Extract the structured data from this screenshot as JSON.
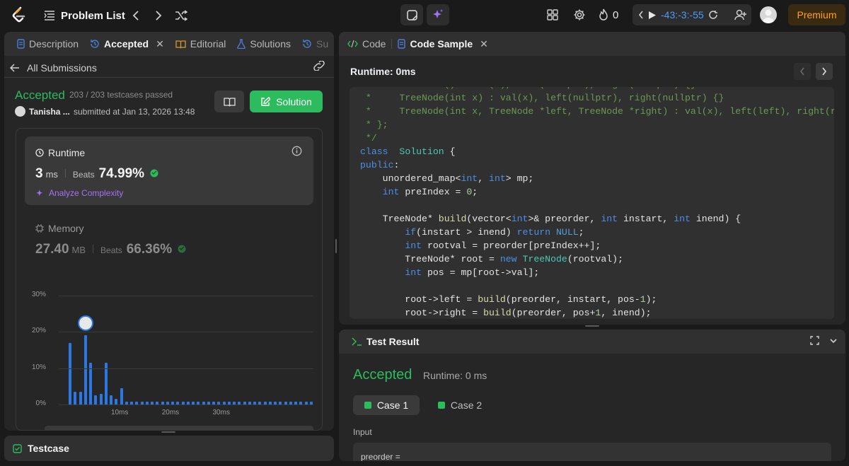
{
  "topbar": {
    "problem_list": "Problem List",
    "streak": "0",
    "timer": "-43:-3:-55",
    "premium": "Premium"
  },
  "left_tabs": [
    "Description",
    "Accepted",
    "Editorial",
    "Solutions",
    "Su"
  ],
  "submission": {
    "back_label": "All Submissions",
    "status": "Accepted",
    "testcases": "203 / 203 testcases passed",
    "user": "Tanisha ...",
    "submitted": "submitted at Jan 13, 2026 13:48",
    "solution_button": "Solution"
  },
  "runtime": {
    "label": "Runtime",
    "value": "3",
    "unit": "ms",
    "beats_label": "Beats",
    "beats": "74.99%",
    "analyze": "Analyze Complexity"
  },
  "memory": {
    "label": "Memory",
    "value": "27.40",
    "unit": "MB",
    "beats_label": "Beats",
    "beats": "66.36%"
  },
  "chart_data": {
    "type": "bar",
    "y_ticks": [
      "30%",
      "20%",
      "10%",
      "0%"
    ],
    "x_ticks": [
      "10ms",
      "20ms",
      "30ms"
    ],
    "ylim": [
      0,
      30
    ],
    "values": [
      17,
      3.5,
      3.5,
      19,
      11.5,
      2.5,
      3,
      11.5,
      2.5,
      1.5,
      4.5,
      0.8,
      0.8,
      0.8,
      0.8,
      0.8,
      0.8,
      0.8,
      0.8,
      0.8,
      0.8,
      0.8,
      0.8,
      0.8,
      0.8,
      0.8,
      0.8,
      0.8,
      0.8,
      0.8,
      0.8,
      0.8,
      0.8,
      0.8,
      0.8,
      0.8,
      0.8,
      0.8,
      0.8,
      0.8,
      0.8,
      0.8,
      0.8,
      0.8,
      0.8,
      0.8,
      0.8,
      0.8
    ],
    "highlight_index": 3
  },
  "testcase_panel": {
    "label": "Testcase"
  },
  "code_tabs": [
    "Code",
    "Code Sample"
  ],
  "code_runtime": "Runtime: 0ms",
  "code_lines": [
    [
      [
        "cm",
        " *     TreeNode() : val(0), left(nullptr), right(nullptr) {}"
      ]
    ],
    [
      [
        "cm",
        " *     TreeNode(int x) : val(x), left(nullptr), right(nullptr) {}"
      ]
    ],
    [
      [
        "cm",
        " *     TreeNode(int x, TreeNode *left, TreeNode *right) : val(x), left(left), right(right) {}"
      ]
    ],
    [
      [
        "cm",
        " * };"
      ]
    ],
    [
      [
        "cm",
        " */"
      ]
    ],
    [
      [
        "kw",
        "class"
      ],
      [
        "",
        "  "
      ],
      [
        "ty",
        "Solution"
      ],
      [
        "",
        " {"
      ]
    ],
    [
      [
        "kw",
        "public"
      ],
      [
        "",
        ":"
      ]
    ],
    [
      [
        "",
        "    unordered_map<"
      ],
      [
        "kw",
        "int"
      ],
      [
        "",
        ", "
      ],
      [
        "kw",
        "int"
      ],
      [
        "",
        "> mp;"
      ]
    ],
    [
      [
        "",
        "    "
      ],
      [
        "kw",
        "int"
      ],
      [
        "",
        " preIndex = "
      ],
      [
        "nu",
        "0"
      ],
      [
        "",
        ";"
      ]
    ],
    [
      [
        "",
        ""
      ]
    ],
    [
      [
        "",
        "    TreeNode* "
      ],
      [
        "fn",
        "build"
      ],
      [
        "",
        "(vector<"
      ],
      [
        "kw",
        "int"
      ],
      [
        "",
        ">& preorder, "
      ],
      [
        "kw",
        "int"
      ],
      [
        "",
        " instart, "
      ],
      [
        "kw",
        "int"
      ],
      [
        "",
        " inend) {"
      ]
    ],
    [
      [
        "",
        "        "
      ],
      [
        "kw",
        "if"
      ],
      [
        "",
        "(instart > inend) "
      ],
      [
        "kw",
        "return"
      ],
      [
        "",
        ""
      ],
      [
        "nl",
        " NULL"
      ],
      [
        "",
        ";"
      ]
    ],
    [
      [
        "",
        "        "
      ],
      [
        "kw",
        "int"
      ],
      [
        "",
        " rootval = preorder[preIndex++];"
      ]
    ],
    [
      [
        "",
        "        TreeNode* root = "
      ],
      [
        "kw",
        "new"
      ],
      [
        "",
        " "
      ],
      [
        "ty",
        "TreeNode"
      ],
      [
        "",
        "(rootval);"
      ]
    ],
    [
      [
        "",
        "        "
      ],
      [
        "kw",
        "int"
      ],
      [
        "",
        " pos = mp[root->val];"
      ]
    ],
    [
      [
        "",
        ""
      ]
    ],
    [
      [
        "",
        "        root->left = "
      ],
      [
        "fn",
        "build"
      ],
      [
        "",
        "(preorder, instart, pos-"
      ],
      [
        "nu",
        "1"
      ],
      [
        "",
        ");"
      ]
    ],
    [
      [
        "",
        "        root->right = "
      ],
      [
        "fn",
        "build"
      ],
      [
        "",
        "(preorder, pos+"
      ],
      [
        "nu",
        "1"
      ],
      [
        "",
        ", inend);"
      ]
    ]
  ],
  "test_result": {
    "title": "Test Result",
    "status": "Accepted",
    "runtime": "Runtime: 0 ms",
    "cases": [
      "Case 1",
      "Case 2"
    ],
    "input_label": "Input",
    "input_value": "preorder ="
  },
  "colors": {
    "accent_green": "#2cbb5d",
    "bar_blue": "#2b78e4",
    "premium": "#ffa116"
  }
}
